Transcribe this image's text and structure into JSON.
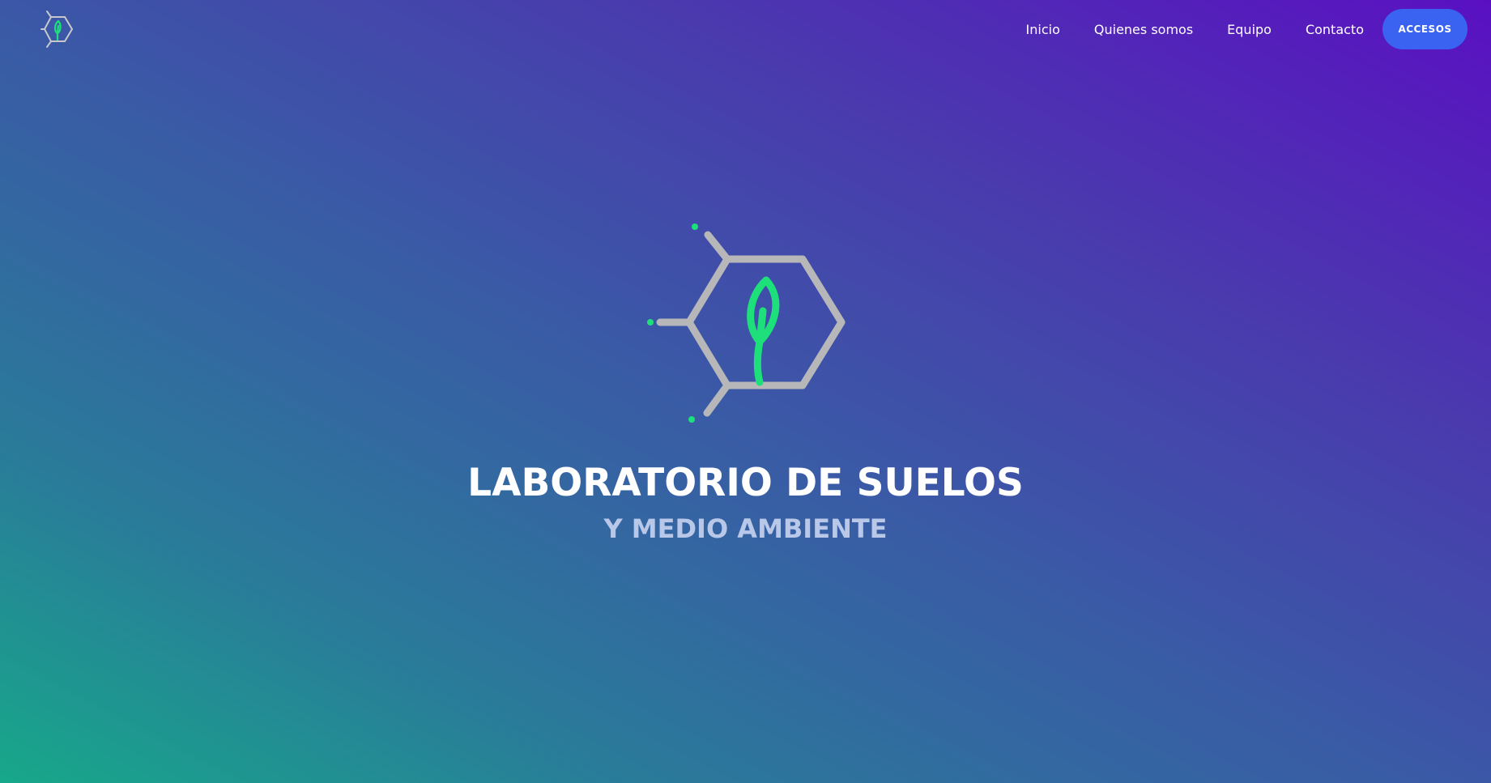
{
  "nav": {
    "links": [
      "Inicio",
      "Quienes somos",
      "Equipo",
      "Contacto"
    ],
    "cta_label": "ACCESOS"
  },
  "hero": {
    "title": "LABORATORIO DE SUELOS",
    "subtitle": "Y MEDIO AMBIENTE"
  },
  "colors": {
    "accent_button": "#3a63f2",
    "leaf_green": "#1ee07a",
    "hexagon_gray": "#b7b7b9",
    "gradient_start": "#17a88a",
    "gradient_end": "#5a10c2"
  },
  "icons": {
    "brand": "hexagon-leaf-logo-icon",
    "hero": "hexagon-leaf-logo-icon"
  }
}
